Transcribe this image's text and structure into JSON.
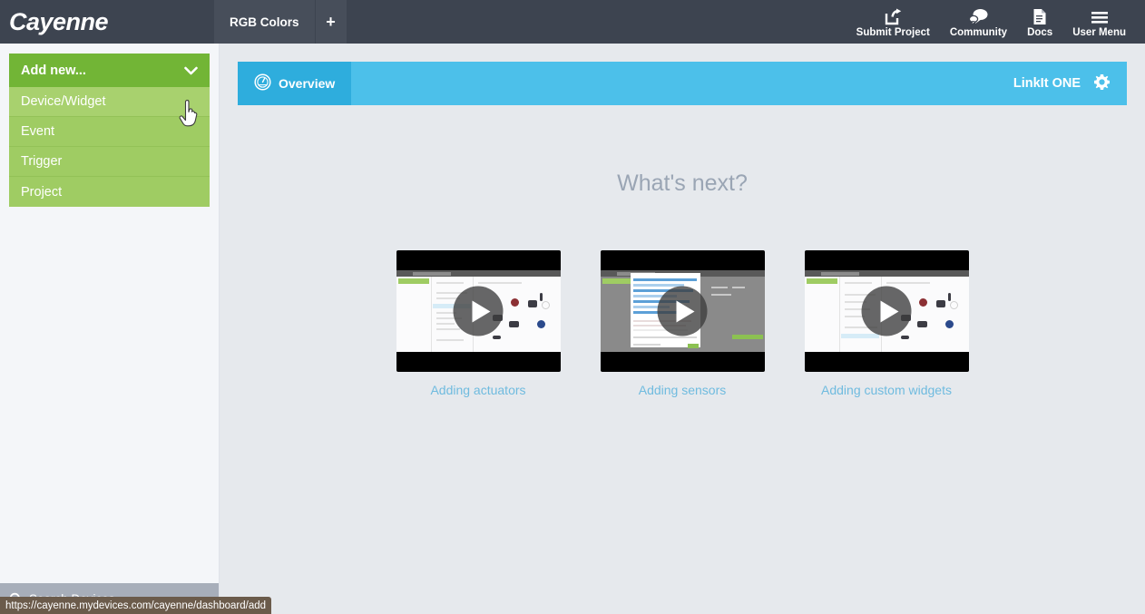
{
  "topbar": {
    "logo": "Cayenne",
    "tabs": [
      {
        "label": "RGB Colors"
      }
    ],
    "add_tab_label": "+",
    "actions": [
      {
        "label": "Submit Project",
        "icon": "share-icon"
      },
      {
        "label": "Community",
        "icon": "chat-bubbles-icon"
      },
      {
        "label": "Docs",
        "icon": "document-icon"
      },
      {
        "label": "User Menu",
        "icon": "hamburger-icon"
      }
    ]
  },
  "sidebar": {
    "dropdown": {
      "title": "Add new...",
      "caret_icon": "chevron-down-icon",
      "items": [
        {
          "label": "Device/Widget"
        },
        {
          "label": "Event"
        },
        {
          "label": "Trigger"
        },
        {
          "label": "Project"
        }
      ]
    },
    "search": {
      "label": "Search Devices",
      "icon": "search-icon"
    }
  },
  "main": {
    "panel_header": {
      "tab_label": "Overview",
      "tab_icon": "gauge-icon",
      "device_name": "LinkIt ONE",
      "settings_icon": "gear-icon"
    },
    "whats_next": {
      "heading": "What's next?",
      "cards": [
        {
          "label": "Adding actuators",
          "play_icon": "play-icon"
        },
        {
          "label": "Adding sensors",
          "play_icon": "play-icon"
        },
        {
          "label": "Adding custom widgets",
          "play_icon": "play-icon"
        }
      ]
    }
  },
  "statusbar": {
    "url": "https://cayenne.mydevices.com/cayenne/dashboard/add"
  },
  "colors": {
    "topbar_bg": "#3d4450",
    "tab_bg": "#474e5a",
    "dropdown_head": "#72b536",
    "dropdown_item": "#9fcc63",
    "dropdown_item_hover": "#a8d16e",
    "panel_header_bg": "#4cc0ea",
    "panel_tab_bg": "#2eaddd",
    "main_bg": "#e6e9ed",
    "sidebar_bg": "#f4f6f9",
    "link_blue": "#6fbbdf",
    "statusbar_bg": "#6b5b4b"
  }
}
